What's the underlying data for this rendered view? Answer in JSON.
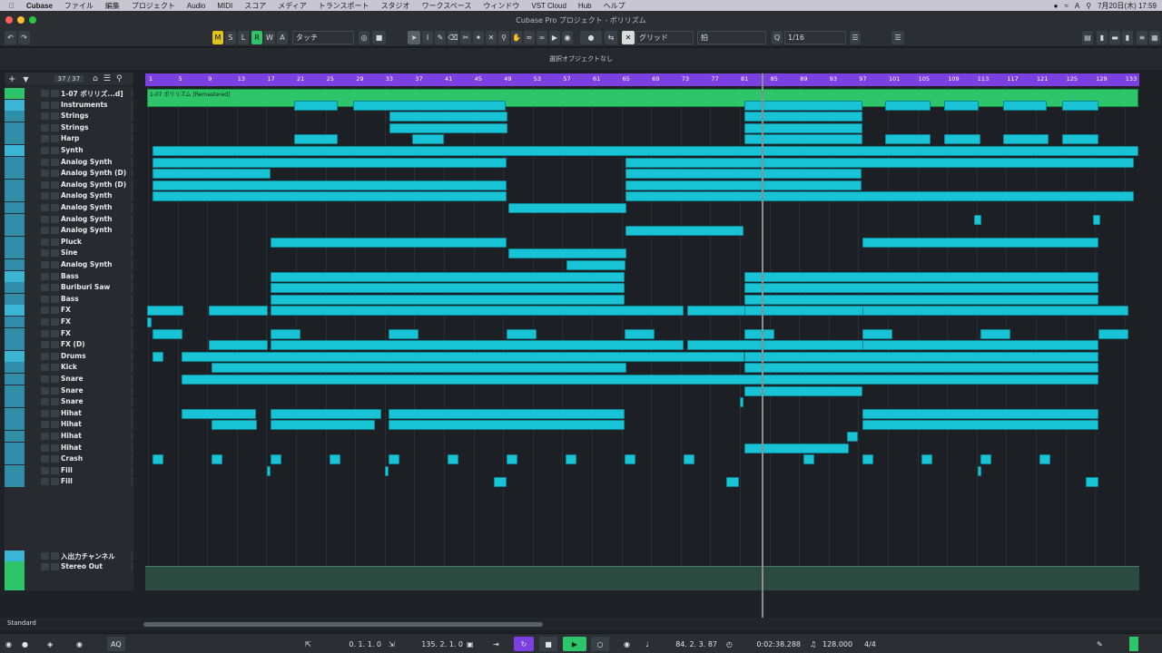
{
  "menubar": {
    "app": "Cubase",
    "items": [
      "ファイル",
      "編集",
      "プロジェクト",
      "Audio",
      "MIDI",
      "スコア",
      "メディア",
      "トランスポート",
      "スタジオ",
      "ワークスペース",
      "ウィンドウ",
      "VST Cloud",
      "Hub",
      "ヘルプ"
    ],
    "clock": "7月20日(木) 17:59"
  },
  "window": {
    "title": "Cubase Pro プロジェクト - ポリリズム"
  },
  "toolbar": {
    "m": "M",
    "s": "S",
    "l": "L",
    "r": "R",
    "w": "W",
    "a": "A",
    "automation_mode": "タッチ",
    "snap_type": "グリッド",
    "grid_type": "拍",
    "quantize": "1/16"
  },
  "infoline": {
    "text": "選択オブジェクトなし"
  },
  "trackheader": {
    "count": "37 / 37"
  },
  "tracks": [
    {
      "name": "1-07 ポリリズ...d]",
      "folder": false
    },
    {
      "name": "Instruments",
      "folder": true
    },
    {
      "name": "Strings",
      "folder": false
    },
    {
      "name": "Strings",
      "folder": false
    },
    {
      "name": "Harp",
      "folder": false
    },
    {
      "name": "Synth",
      "folder": true
    },
    {
      "name": "Analog Synth",
      "folder": false
    },
    {
      "name": "Analog Synth (D)",
      "folder": false
    },
    {
      "name": "Analog Synth (D)",
      "folder": false
    },
    {
      "name": "Analog Synth",
      "folder": false
    },
    {
      "name": "Analog Synth",
      "folder": false
    },
    {
      "name": "Analog Synth",
      "folder": false
    },
    {
      "name": "Analog Synth",
      "folder": false
    },
    {
      "name": "Pluck",
      "folder": false
    },
    {
      "name": "Sine",
      "folder": false
    },
    {
      "name": "Analog Synth",
      "folder": false
    },
    {
      "name": "Bass",
      "folder": true
    },
    {
      "name": "Buriburi Saw",
      "folder": false
    },
    {
      "name": "Bass",
      "folder": false
    },
    {
      "name": "FX",
      "folder": true
    },
    {
      "name": "FX",
      "folder": false
    },
    {
      "name": "FX",
      "folder": false
    },
    {
      "name": "FX (D)",
      "folder": false
    },
    {
      "name": "Drums",
      "folder": true
    },
    {
      "name": "Kick",
      "folder": false
    },
    {
      "name": "Snare",
      "folder": false
    },
    {
      "name": "Snare",
      "folder": false
    },
    {
      "name": "Snare",
      "folder": false
    },
    {
      "name": "Hihat",
      "folder": false
    },
    {
      "name": "Hihat",
      "folder": false
    },
    {
      "name": "Hihat",
      "folder": false
    },
    {
      "name": "Hihat",
      "folder": false
    },
    {
      "name": "Crash",
      "folder": false
    },
    {
      "name": "Fill",
      "folder": false
    },
    {
      "name": "Fill",
      "folder": false
    },
    {
      "name": "入出力チャンネル",
      "folder": true
    },
    {
      "name": "Stereo Out",
      "folder": false
    }
  ],
  "ruler": {
    "bars": [
      "1",
      "5",
      "9",
      "13",
      "17",
      "21",
      "25",
      "29",
      "33",
      "37",
      "41",
      "45",
      "49",
      "53",
      "57",
      "61",
      "65",
      "69",
      "73",
      "77",
      "81",
      "85",
      "89",
      "93",
      "97",
      "101",
      "105",
      "109",
      "113",
      "117",
      "121",
      "125",
      "129",
      "133"
    ]
  },
  "audio_event": {
    "label": "1-07 ポリリズム [Remastered]"
  },
  "bottom": {
    "preset": "Standard"
  },
  "transport": {
    "left_locator": "0. 1. 1.   0",
    "right_locator": "135. 2. 1.   0",
    "position": "84. 2. 3. 87",
    "time": "0:02:38.288",
    "tempo": "128.000",
    "signature": "4/4",
    "aq": "AQ"
  },
  "colors": {
    "accent": "#19c3d6",
    "ruler": "#7c3fe0",
    "audio_green": "#2ec46a"
  }
}
